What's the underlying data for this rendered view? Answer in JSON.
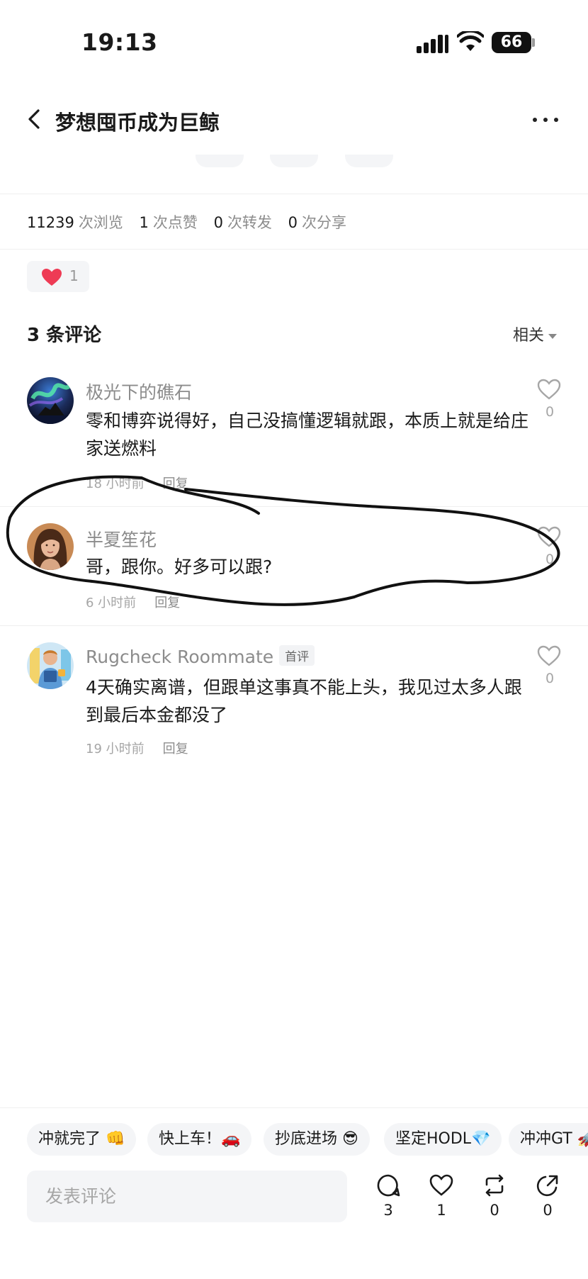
{
  "status_bar": {
    "time": "19:13",
    "battery": "66"
  },
  "header": {
    "title": "梦想囤币成为巨鲸"
  },
  "stats": [
    {
      "value": "11239",
      "label": "次浏览"
    },
    {
      "value": "1",
      "label": "次点赞"
    },
    {
      "value": "0",
      "label": "次转发"
    },
    {
      "value": "0",
      "label": "次分享"
    }
  ],
  "reaction": {
    "count": "1"
  },
  "comments_header": {
    "title": "3 条评论",
    "sort": "相关"
  },
  "comments": [
    {
      "author": "极光下的礁石",
      "text": "零和博弈说得好，自己没搞懂逻辑就跟，本质上就是给庄家送燃料",
      "time": "18 小时前",
      "reply": "回复",
      "likes": "0"
    },
    {
      "author": "半夏笙花",
      "text": "哥，跟你。好多可以跟?",
      "time": "6 小时前",
      "reply": "回复",
      "likes": "0"
    },
    {
      "author": "Rugcheck Roommate",
      "badge": "首评",
      "text": "4天确实离谱，但跟单这事真不能上头，我见过太多人跟到最后本金都没了",
      "time": "19 小时前",
      "reply": "回复",
      "likes": "0"
    }
  ],
  "quick_replies": [
    "冲就完了 👊",
    "快上车！🚗",
    "抄底进场 😎",
    "坚定HODL💎",
    "冲冲GT 🚀"
  ],
  "composer": {
    "placeholder": "发表评论"
  },
  "actions": {
    "comments": "3",
    "likes": "1",
    "reposts": "0",
    "shares": "0"
  }
}
